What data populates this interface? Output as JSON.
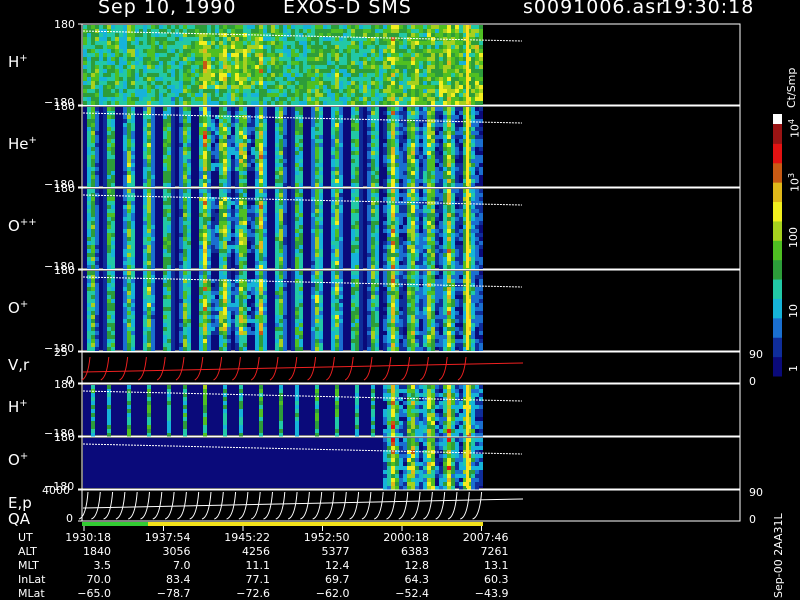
{
  "header": {
    "date": "Sep 10, 1990",
    "instrument": "EXOS-D SMS",
    "file": "s0091006.asr",
    "time": "19:30:18"
  },
  "chart_data": {
    "type": "heatmap",
    "panels": [
      {
        "label": "H",
        "charge": "+",
        "ytop": "180",
        "ybot": "−180"
      },
      {
        "label": "He",
        "charge": "+",
        "ytop": "180",
        "ybot": "−180"
      },
      {
        "label": "O",
        "charge": "++",
        "ytop": "180",
        "ybot": "−180"
      },
      {
        "label": "O",
        "charge": "+",
        "ytop": "180",
        "ybot": "−180"
      },
      {
        "label": "V,r",
        "charge": "",
        "ytop": "25",
        "ybot": "0",
        "rtop": "90",
        "rbot": "0"
      },
      {
        "label": "H",
        "charge": "+",
        "ytop": "180",
        "ybot": "−180"
      },
      {
        "label": "O",
        "charge": "+",
        "ytop": "180",
        "ybot": "−180"
      },
      {
        "label": "E,p",
        "label2": "QA",
        "charge": "",
        "ytop": "4000",
        "ybot": "0",
        "rtop": "90",
        "rbot": "0"
      }
    ],
    "colorbar": {
      "unit": "Ct/Smp",
      "ticks": [
        {
          "label": "1",
          "sup": ""
        },
        {
          "label": "10",
          "sup": ""
        },
        {
          "label": "100",
          "sup": ""
        },
        {
          "label": "10",
          "sup": "3"
        },
        {
          "label": "10",
          "sup": "4"
        }
      ]
    },
    "footer": {
      "labels": [
        "UT",
        "ALT",
        "MLT",
        "InLat",
        "MLat"
      ],
      "columns": [
        [
          "1930:18",
          "1840",
          "3.5",
          "70.0",
          "−65.0"
        ],
        [
          "1937:54",
          "3056",
          "7.0",
          "83.4",
          "−78.7"
        ],
        [
          "1945:22",
          "4256",
          "11.1",
          "77.1",
          "−72.6"
        ],
        [
          "1952:50",
          "5377",
          "12.4",
          "69.7",
          "−62.0"
        ],
        [
          "2000:18",
          "6383",
          "12.8",
          "64.3",
          "−52.4"
        ],
        [
          "2007:46",
          "7261",
          "13.1",
          "60.3",
          "−43.9"
        ]
      ]
    },
    "side_label": "Sep-00  2AA31L"
  }
}
